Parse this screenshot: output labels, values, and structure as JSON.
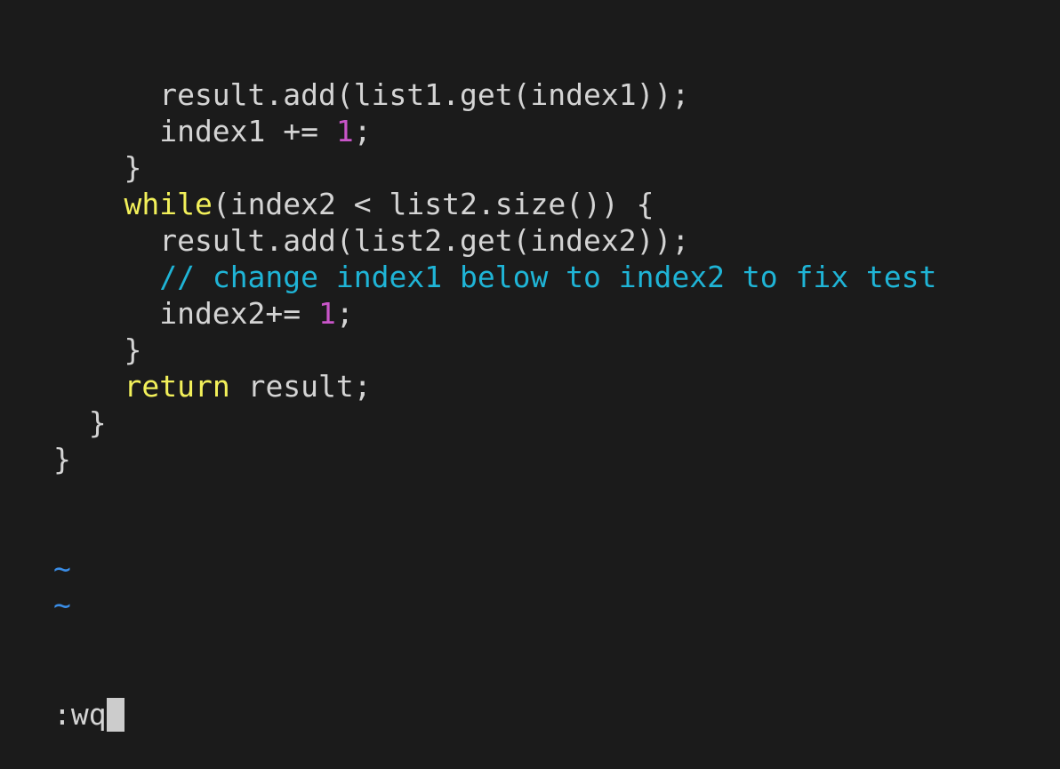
{
  "colors": {
    "background": "#1b1b1b",
    "text": "#d4d4d4",
    "keyword": "#f2f05a",
    "comment": "#1fb4d6",
    "number": "#c955c9",
    "tilde": "#3a8de6",
    "cursor": "#cccccc"
  },
  "buffer": [
    [
      [
        "      result.add(list1.get(index1));",
        "plain"
      ]
    ],
    [
      [
        "      index1 += ",
        "plain"
      ],
      [
        "1",
        "num"
      ],
      [
        ";",
        "plain"
      ]
    ],
    [
      [
        "    }",
        "plain"
      ]
    ],
    [
      [
        "    ",
        "plain"
      ],
      [
        "while",
        "kw"
      ],
      [
        "(index2 < list2.size()) {",
        "plain"
      ]
    ],
    [
      [
        "      result.add(list2.get(index2));",
        "plain"
      ]
    ],
    [
      [
        "      ",
        "plain"
      ],
      [
        "// change index1 below to index2 to fix test",
        "cm"
      ]
    ],
    [
      [
        "      index2+= ",
        "plain"
      ],
      [
        "1",
        "num"
      ],
      [
        ";",
        "plain"
      ]
    ],
    [
      [
        "    }",
        "plain"
      ]
    ],
    [
      [
        "    ",
        "plain"
      ],
      [
        "return",
        "kw"
      ],
      [
        " result;",
        "plain"
      ]
    ],
    [
      [
        "  }",
        "plain"
      ]
    ],
    [
      [
        "}",
        "plain"
      ]
    ],
    [],
    [],
    [
      [
        "~",
        "tilde"
      ]
    ],
    [
      [
        "~",
        "tilde"
      ]
    ]
  ],
  "command_line": ":wq"
}
